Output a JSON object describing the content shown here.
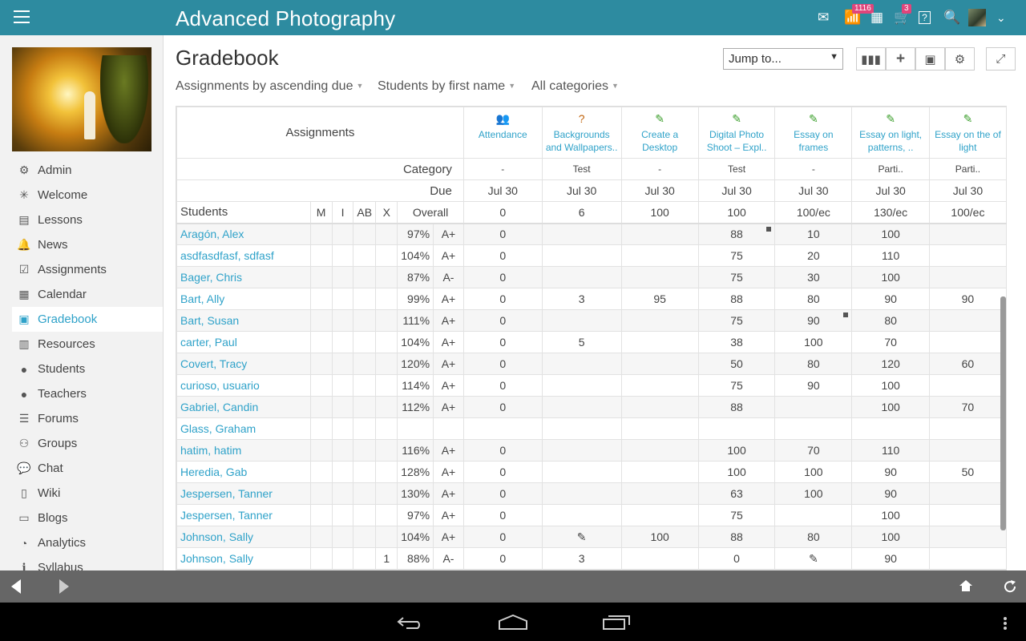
{
  "app": {
    "title": "Advanced Photography"
  },
  "topbar": {
    "mail_badge": "1116",
    "cart_badge": "3"
  },
  "sidebar": {
    "items": [
      {
        "label": "Admin",
        "icon": "gear-icon",
        "glyph": "⚙"
      },
      {
        "label": "Welcome",
        "icon": "sparkle-icon",
        "glyph": "✳"
      },
      {
        "label": "Lessons",
        "icon": "lessons-icon",
        "glyph": "▤"
      },
      {
        "label": "News",
        "icon": "bell-icon",
        "glyph": "🔔"
      },
      {
        "label": "Assignments",
        "icon": "assignments-icon",
        "glyph": "☑"
      },
      {
        "label": "Calendar",
        "icon": "calendar-icon",
        "glyph": "▦"
      },
      {
        "label": "Gradebook",
        "icon": "gradebook-icon",
        "glyph": "▣"
      },
      {
        "label": "Resources",
        "icon": "resources-icon",
        "glyph": "▥"
      },
      {
        "label": "Students",
        "icon": "student-icon",
        "glyph": "●"
      },
      {
        "label": "Teachers",
        "icon": "teacher-icon",
        "glyph": "●"
      },
      {
        "label": "Forums",
        "icon": "forums-icon",
        "glyph": "☰"
      },
      {
        "label": "Groups",
        "icon": "groups-icon",
        "glyph": "⚇"
      },
      {
        "label": "Chat",
        "icon": "chat-icon",
        "glyph": "💬"
      },
      {
        "label": "Wiki",
        "icon": "wiki-icon",
        "glyph": "▯"
      },
      {
        "label": "Blogs",
        "icon": "blogs-icon",
        "glyph": "▭"
      },
      {
        "label": "Analytics",
        "icon": "analytics-icon",
        "glyph": "◔"
      },
      {
        "label": "Syllabus",
        "icon": "info-icon",
        "glyph": "ℹ"
      }
    ],
    "active": "Gradebook"
  },
  "main": {
    "title": "Gradebook",
    "jump_placeholder": "Jump to...",
    "filters": [
      "Assignments by ascending due",
      "Students by first name",
      "All categories"
    ]
  },
  "grid": {
    "assignments_header": "Assignments",
    "category_label": "Category",
    "due_label": "Due",
    "students_label": "Students",
    "col_m": "M",
    "col_i": "I",
    "col_ab": "AB",
    "col_x": "X",
    "col_overall": "Overall",
    "assignments": [
      {
        "name": "Attendance",
        "icon": "attendance-icon",
        "glyph": "👥",
        "color": "#2fa2c9",
        "category": "-",
        "due": "Jul 30",
        "points": "0"
      },
      {
        "name": "Backgrounds and Wallpapers..",
        "icon": "quiz-icon",
        "glyph": "?",
        "color": "#c0630b",
        "category": "Test",
        "due": "Jul 30",
        "points": "6"
      },
      {
        "name": "Create a Desktop",
        "icon": "pencil-icon",
        "glyph": "✎",
        "color": "#3a9e2a",
        "category": "-",
        "due": "Jul 30",
        "points": "100"
      },
      {
        "name": "Digital Photo Shoot – Expl..",
        "icon": "pencil-icon",
        "glyph": "✎",
        "color": "#3a9e2a",
        "category": "Test",
        "due": "Jul 30",
        "points": "100"
      },
      {
        "name": "Essay on frames",
        "icon": "pencil-icon",
        "glyph": "✎",
        "color": "#3a9e2a",
        "category": "-",
        "due": "Jul 30",
        "points": "100/ec"
      },
      {
        "name": "Essay on light, patterns, ..",
        "icon": "pencil-icon",
        "glyph": "✎",
        "color": "#3a9e2a",
        "category": "Parti..",
        "due": "Jul 30",
        "points": "130/ec"
      },
      {
        "name": "Essay on the of light",
        "icon": "pencil-icon",
        "glyph": "✎",
        "color": "#3a9e2a",
        "category": "Parti..",
        "due": "Jul 30",
        "points": "100/ec"
      }
    ],
    "students": [
      {
        "name": "Aragón, Alex",
        "x": "",
        "pct": "97%",
        "grade": "A+",
        "scores": [
          "0",
          "",
          "",
          "88",
          "10",
          "100",
          ""
        ],
        "flags": [
          3
        ]
      },
      {
        "name": "asdfasdfasf, sdfasf",
        "x": "",
        "pct": "104%",
        "grade": "A+",
        "scores": [
          "0",
          "",
          "",
          "75",
          "20",
          "110",
          ""
        ]
      },
      {
        "name": "Bager, Chris",
        "x": "",
        "pct": "87%",
        "grade": "A-",
        "scores": [
          "0",
          "",
          "",
          "75",
          "30",
          "100",
          ""
        ]
      },
      {
        "name": "Bart, Ally",
        "x": "",
        "pct": "99%",
        "grade": "A+",
        "scores": [
          "0",
          "3",
          "95",
          "88",
          "80",
          "90",
          "90"
        ]
      },
      {
        "name": "Bart, Susan",
        "x": "",
        "pct": "111%",
        "grade": "A+",
        "scores": [
          "0",
          "",
          "",
          "75",
          "90",
          "80",
          ""
        ],
        "flags": [
          4
        ]
      },
      {
        "name": "carter, Paul",
        "x": "",
        "pct": "104%",
        "grade": "A+",
        "scores": [
          "0",
          "5",
          "",
          "38",
          "100",
          "70",
          ""
        ]
      },
      {
        "name": "Covert, Tracy",
        "x": "",
        "pct": "120%",
        "grade": "A+",
        "scores": [
          "0",
          "",
          "",
          "50",
          "80",
          "120",
          "60"
        ]
      },
      {
        "name": "curioso, usuario",
        "x": "",
        "pct": "114%",
        "grade": "A+",
        "scores": [
          "0",
          "",
          "",
          "75",
          "90",
          "100",
          ""
        ]
      },
      {
        "name": "Gabriel, Candin",
        "x": "",
        "pct": "112%",
        "grade": "A+",
        "scores": [
          "0",
          "",
          "",
          "88",
          "",
          "100",
          "70"
        ]
      },
      {
        "name": "Glass, Graham",
        "x": "",
        "pct": "",
        "grade": "",
        "scores": [
          "",
          "",
          "",
          "",
          "",
          "",
          ""
        ]
      },
      {
        "name": "hatim, hatim",
        "x": "",
        "pct": "116%",
        "grade": "A+",
        "scores": [
          "0",
          "",
          "",
          "100",
          "70",
          "110",
          ""
        ]
      },
      {
        "name": "Heredia, Gab",
        "x": "",
        "pct": "128%",
        "grade": "A+",
        "scores": [
          "0",
          "",
          "",
          "100",
          "100",
          "90",
          "50"
        ]
      },
      {
        "name": "Jespersen, Tanner",
        "x": "",
        "pct": "130%",
        "grade": "A+",
        "scores": [
          "0",
          "",
          "",
          "63",
          "100",
          "90",
          ""
        ]
      },
      {
        "name": "Jespersen, Tanner",
        "x": "",
        "pct": "97%",
        "grade": "A+",
        "scores": [
          "0",
          "",
          "",
          "75",
          "",
          "100",
          ""
        ]
      },
      {
        "name": "Johnson, Sally",
        "x": "",
        "pct": "104%",
        "grade": "A+",
        "scores": [
          "0",
          "✎",
          "100",
          "88",
          "80",
          "100",
          ""
        ]
      },
      {
        "name": "Johnson, Sally",
        "x": "1",
        "pct": "88%",
        "grade": "A-",
        "scores": [
          "0",
          "3",
          "",
          "0",
          "✎",
          "90",
          ""
        ]
      }
    ]
  }
}
